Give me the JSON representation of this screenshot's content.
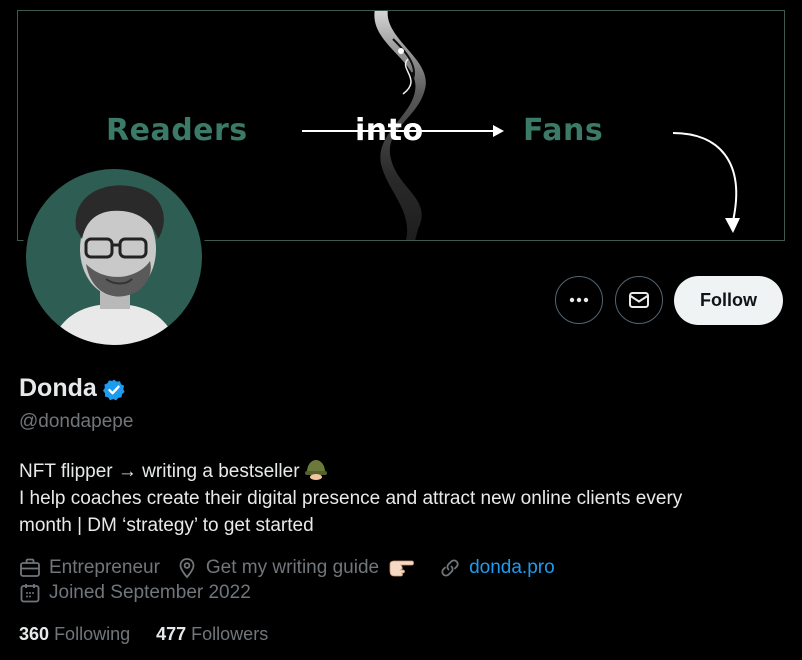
{
  "banner": {
    "word_left": "Readers",
    "word_middle": "into",
    "word_right": "Fans"
  },
  "actions": {
    "more_icon": "more-horizontal-icon",
    "message_icon": "envelope-icon",
    "follow_label": "Follow"
  },
  "profile": {
    "name": "Donda",
    "handle": "@dondapepe",
    "verified": true,
    "bio_line1": "NFT flipper → writing a bestseller",
    "bio_line2": "I help coaches create their digital presence and attract new online clients every",
    "bio_line3": "month | DM ‘strategy’ to get started",
    "category": "Entrepreneur",
    "location": "Get my writing guide",
    "website": "donda.pro",
    "joined": "Joined September 2022"
  },
  "stats": {
    "following_count": "360",
    "following_label": "Following",
    "followers_count": "477",
    "followers_label": "Followers"
  },
  "colors": {
    "background": "#000000",
    "accent_link": "#1d9bf0",
    "muted_text": "#71767b",
    "banner_green": "#3c7a68"
  }
}
